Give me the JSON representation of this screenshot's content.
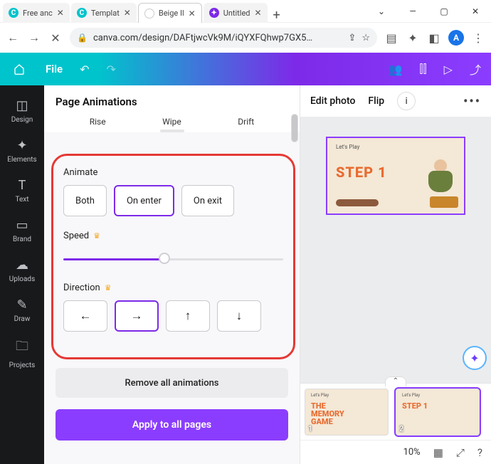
{
  "browser": {
    "tabs": [
      {
        "title": "Free anc",
        "fav_bg": "#00c4cc",
        "fav_txt": "C"
      },
      {
        "title": "Templat",
        "fav_bg": "#00c4cc",
        "fav_txt": "C"
      },
      {
        "title": "Beige Il",
        "fav_bg": "#ffffff",
        "fav_txt": ""
      },
      {
        "title": "Untitled",
        "fav_bg": "#7d2ae8",
        "fav_txt": "✦"
      }
    ],
    "url": "canva.com/design/DAFtjwcVk9M/iQYXFQhwp7GX5…",
    "avatar_letter": "A"
  },
  "canva_header": {
    "file_label": "File"
  },
  "rail": {
    "items": [
      "Design",
      "Elements",
      "Text",
      "Brand",
      "Uploads",
      "Draw",
      "Projects"
    ]
  },
  "panel": {
    "title": "Page Animations",
    "top_tabs": [
      "Rise",
      "Wipe",
      "Drift"
    ],
    "animate_label": "Animate",
    "animate_opts": {
      "both": "Both",
      "on_enter": "On enter",
      "on_exit": "On exit"
    },
    "animate_selected": "on_enter",
    "speed_label": "Speed",
    "speed_percent": 46,
    "direction_label": "Direction",
    "direction_selected": "right",
    "remove_label": "Remove all animations",
    "apply_label": "Apply to all pages"
  },
  "canvasbar": {
    "edit_photo": "Edit photo",
    "flip": "Flip"
  },
  "stage_slide": {
    "lets_play": "Let's Play",
    "step": "STEP 1"
  },
  "thumbs": [
    {
      "num": "1",
      "lets_play": "Let's Play",
      "title": "THE\nMEMORY\nGAME",
      "selected": false
    },
    {
      "num": "2",
      "lets_play": "Let's Play",
      "title": "STEP 1",
      "selected": true
    }
  ],
  "zoom": {
    "value": "10%"
  }
}
